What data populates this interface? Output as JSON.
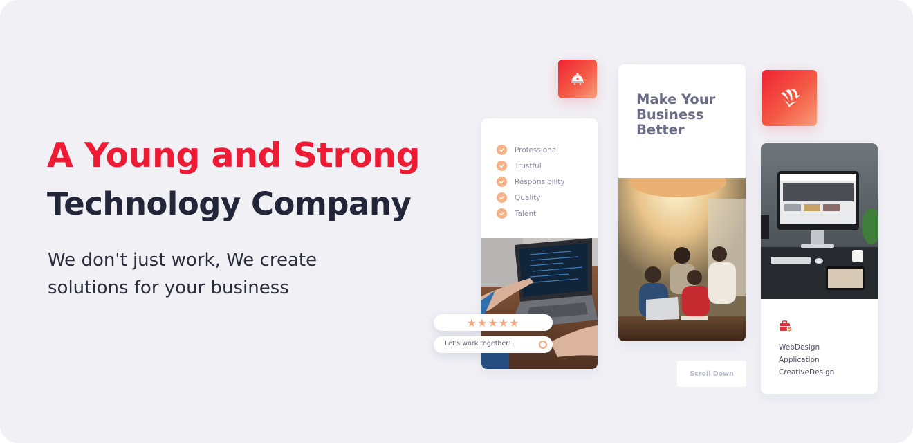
{
  "hero": {
    "headline_line1": "A Young and Strong",
    "headline_line2": "Technology Company",
    "tagline": "We don't just work, We create solutions for your business"
  },
  "features_card": {
    "items": [
      "Professional",
      "Trustful",
      "Responsibility",
      "Quality",
      "Talent"
    ],
    "icon": "check-circle-icon"
  },
  "rating": {
    "stars": "★★★★★",
    "value": 5,
    "max": 5
  },
  "cta": {
    "label": "Let's work together!"
  },
  "middle_card": {
    "title": "Make Your Business Better"
  },
  "scroll": {
    "label": "Scroll Down"
  },
  "services_card": {
    "icon": "briefcase-icon",
    "items": [
      "WebDesign",
      "Application",
      "CreativeDesign"
    ]
  },
  "tiles": {
    "bell_icon": "service-bell-icon",
    "logo_icon": "phoenix-logo-icon"
  },
  "colors": {
    "accent_red": "#ed1c34",
    "dark_text": "#232639",
    "peach": "#f7b186",
    "background": "#f0f0f5"
  }
}
